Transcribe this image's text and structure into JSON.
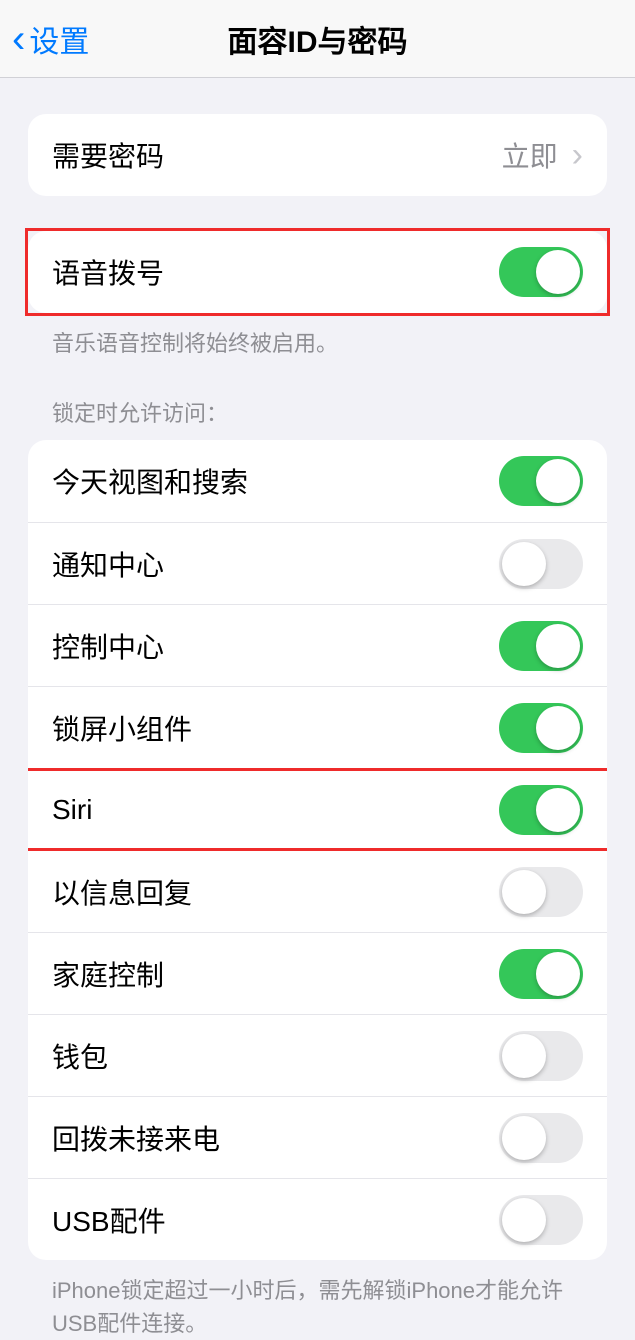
{
  "nav": {
    "back_label": "设置",
    "title": "面容ID与密码"
  },
  "require_passcode": {
    "label": "需要密码",
    "value": "立即"
  },
  "voice_dial": {
    "label": "语音拨号",
    "footer": "音乐语音控制将始终被启用。"
  },
  "lock_section": {
    "header": "锁定时允许访问：",
    "items": [
      {
        "label": "今天视图和搜索",
        "on": true
      },
      {
        "label": "通知中心",
        "on": false
      },
      {
        "label": "控制中心",
        "on": true
      },
      {
        "label": "锁屏小组件",
        "on": true
      },
      {
        "label": "Siri",
        "on": true
      },
      {
        "label": "以信息回复",
        "on": false
      },
      {
        "label": "家庭控制",
        "on": true
      },
      {
        "label": "钱包",
        "on": false
      },
      {
        "label": "回拨未接来电",
        "on": false
      },
      {
        "label": "USB配件",
        "on": false
      }
    ],
    "footer": "iPhone锁定超过一小时后，需先解锁iPhone才能允许USB配件连接。"
  }
}
